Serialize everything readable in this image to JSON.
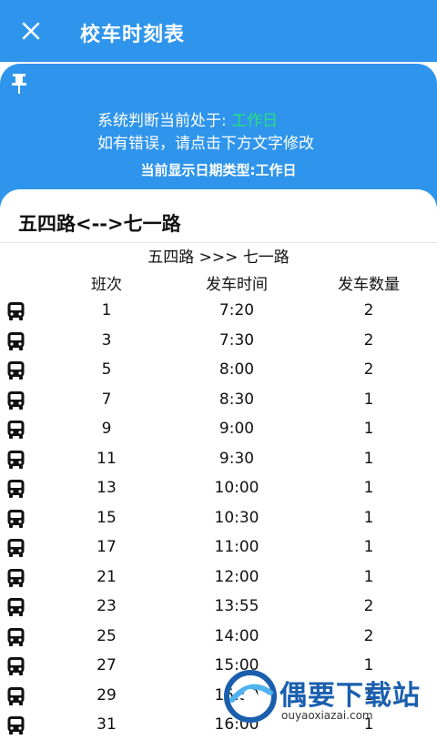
{
  "header": {
    "title": "校车时刻表",
    "close_icon": "close-icon"
  },
  "info": {
    "status_prefix": "系统判断当前处于: ",
    "status_value": "工作日",
    "hint": "如有错误，请点击下方文字修改",
    "date_type": "当前显示日期类型:工作日"
  },
  "route": {
    "title": "五四路<-->七一路",
    "direction": "五四路  >>>  七一路",
    "columns": {
      "run": "班次",
      "time": "发车时间",
      "count": "发车数量"
    },
    "rows": [
      {
        "run": "1",
        "time": "7:20",
        "count": "2"
      },
      {
        "run": "3",
        "time": "7:30",
        "count": "2"
      },
      {
        "run": "5",
        "time": "8:00",
        "count": "2"
      },
      {
        "run": "7",
        "time": "8:30",
        "count": "1"
      },
      {
        "run": "9",
        "time": "9:00",
        "count": "1"
      },
      {
        "run": "11",
        "time": "9:30",
        "count": "1"
      },
      {
        "run": "13",
        "time": "10:00",
        "count": "1"
      },
      {
        "run": "15",
        "time": "10:30",
        "count": "1"
      },
      {
        "run": "17",
        "time": "11:00",
        "count": "1"
      },
      {
        "run": "21",
        "time": "12:00",
        "count": "1"
      },
      {
        "run": "23",
        "time": "13:55",
        "count": "2"
      },
      {
        "run": "25",
        "time": "14:00",
        "count": "2"
      },
      {
        "run": "27",
        "time": "15:00",
        "count": "1"
      },
      {
        "run": "29",
        "time": "15:30",
        "count": "1"
      },
      {
        "run": "31",
        "time": "16:00",
        "count": "1"
      }
    ]
  },
  "watermark": {
    "name": "偶要下载站",
    "url": "ouyaoxiazai.com"
  },
  "colors": {
    "primary": "#2f95ec",
    "status_green": "#27e07a",
    "watermark_blue": "#1a5fae"
  }
}
